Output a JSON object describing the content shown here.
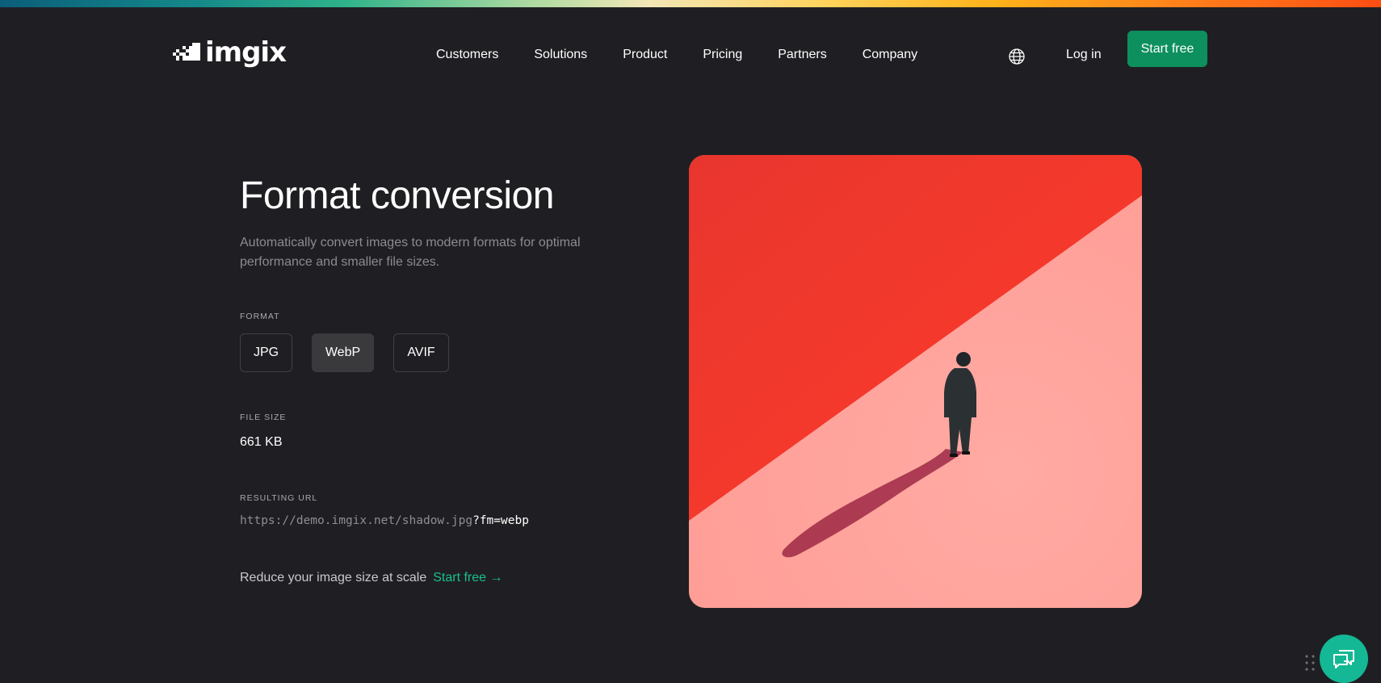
{
  "brand": {
    "name": "imgix",
    "accent": "#0d8f5e",
    "link_color": "#19c08a"
  },
  "nav": {
    "items": [
      {
        "label": "Customers"
      },
      {
        "label": "Solutions"
      },
      {
        "label": "Product"
      },
      {
        "label": "Pricing"
      },
      {
        "label": "Partners"
      },
      {
        "label": "Company"
      }
    ],
    "globe_icon": "globe-icon",
    "login_label": "Log in",
    "start_label": "Start free"
  },
  "hero": {
    "title": "Format conversion",
    "subtitle": "Automatically convert images to modern formats for optimal performance and smaller file sizes."
  },
  "format": {
    "label": "FORMAT",
    "options": [
      {
        "label": "JPG",
        "active": false
      },
      {
        "label": "WebP",
        "active": true
      },
      {
        "label": "AVIF",
        "active": false
      }
    ]
  },
  "file_size": {
    "label": "FILE SIZE",
    "value": "661 KB"
  },
  "resulting_url": {
    "label": "RESULTING URL",
    "base": "https://demo.imgix.net/shadow.jpg",
    "param": "?fm=webp"
  },
  "cta": {
    "text": "Reduce your image size at scale",
    "link": "Start free →"
  },
  "chat": {
    "icon": "chat-icon"
  }
}
